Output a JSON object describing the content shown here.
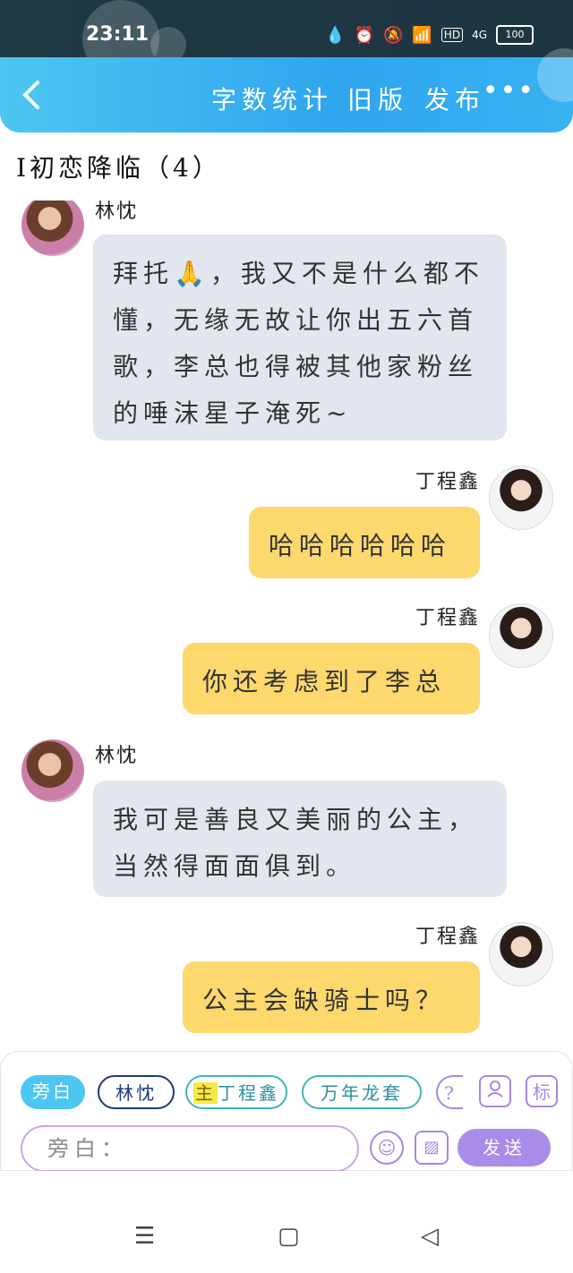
{
  "status_bar": {
    "time": "23:11",
    "icons": [
      "water-drop-icon",
      "alarm-icon",
      "mute-icon",
      "wifi-icon"
    ],
    "hd_label": "HD",
    "network_label": "4G",
    "battery_level": "100"
  },
  "header": {
    "back_icon": "chevron-left-icon",
    "word_count": "字数统计",
    "old_version": "旧版",
    "publish": "发布",
    "more": "•••"
  },
  "title": "I初恋降临（4）",
  "messages": [
    {
      "side": "left",
      "sender": "林忱",
      "text": "拜托🙏，我又不是什么都不懂，无缘无故让你出五六首歌，李总也得被其他家粉丝的唾沫星子淹死~"
    },
    {
      "side": "right",
      "sender": "丁程鑫",
      "text": "哈哈哈哈哈哈"
    },
    {
      "side": "right",
      "sender": "丁程鑫",
      "text": "你还考虑到了李总"
    },
    {
      "side": "left",
      "sender": "林忱",
      "text": "我可是善良又美丽的公主，当然得面面俱到。"
    },
    {
      "side": "right",
      "sender": "丁程鑫",
      "text": "公主会缺骑士吗？"
    }
  ],
  "input_panel": {
    "chips": {
      "narration": "旁白",
      "lin": "林忱",
      "ding_highlight": "主",
      "ding": "丁程鑫",
      "wan": "万年龙套",
      "more": "?"
    },
    "role_icon": "person-icon",
    "mark_label": "标",
    "placeholder": "旁白：",
    "emoji_icon": "☺",
    "image_icon": "▨",
    "send": "发送"
  },
  "nav": {
    "menu": "☰",
    "home": "▢",
    "back": "◁"
  }
}
